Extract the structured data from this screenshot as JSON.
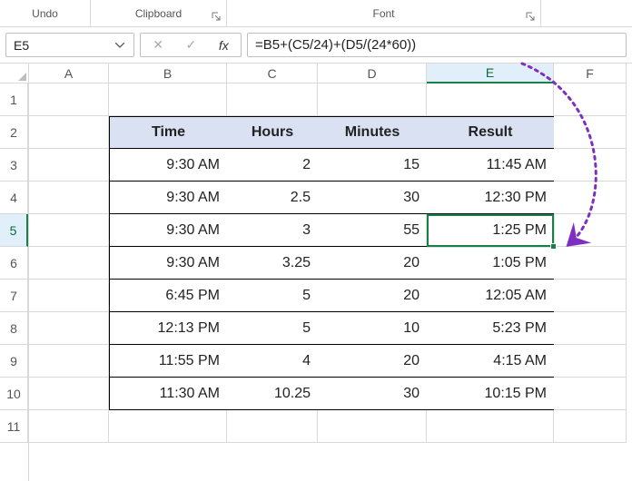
{
  "ribbon": {
    "undo_label": "Undo",
    "clipboard_label": "Clipboard",
    "font_label": "Font"
  },
  "namebox": {
    "value": "E5"
  },
  "fx_toolbar": {
    "cancel_glyph": "✕",
    "enter_glyph": "✓",
    "fx_label": "fx"
  },
  "formula": {
    "value": "=B5+(C5/24)+(D5/(24*60))"
  },
  "colhdrs": [
    "A",
    "B",
    "C",
    "D",
    "E",
    "F"
  ],
  "rowhdrs": [
    "1",
    "2",
    "3",
    "4",
    "5",
    "6",
    "7",
    "8",
    "9",
    "10",
    "11"
  ],
  "selected": {
    "col": "E",
    "row": "5"
  },
  "table": {
    "headers": {
      "b": "Time",
      "c": "Hours",
      "d": "Minutes",
      "e": "Result"
    },
    "rows": [
      {
        "b": "9:30 AM",
        "c": "2",
        "d": "15",
        "e": "11:45 AM"
      },
      {
        "b": "9:30 AM",
        "c": "2.5",
        "d": "30",
        "e": "12:30 PM"
      },
      {
        "b": "9:30 AM",
        "c": "3",
        "d": "55",
        "e": "1:25 PM"
      },
      {
        "b": "9:30 AM",
        "c": "3.25",
        "d": "20",
        "e": "1:05 PM"
      },
      {
        "b": "6:45 PM",
        "c": "5",
        "d": "20",
        "e": "12:05 AM"
      },
      {
        "b": "12:13 PM",
        "c": "5",
        "d": "10",
        "e": "5:23 PM"
      },
      {
        "b": "11:55 PM",
        "c": "4",
        "d": "20",
        "e": "4:15 AM"
      },
      {
        "b": "11:30 AM",
        "c": "10.25",
        "d": "30",
        "e": "10:15 PM"
      }
    ]
  }
}
